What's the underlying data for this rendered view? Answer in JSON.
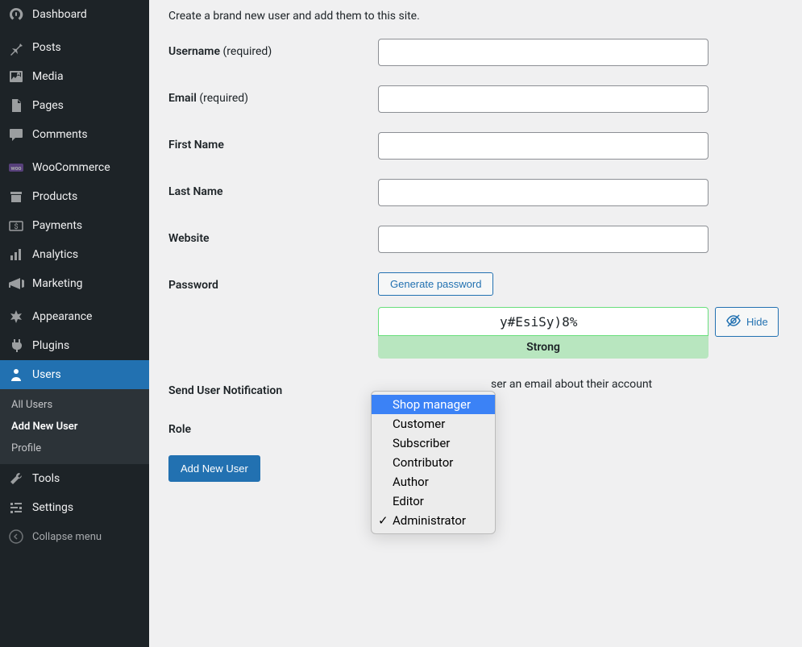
{
  "sidebar": {
    "items": [
      {
        "label": "Dashboard"
      },
      {
        "label": "Posts"
      },
      {
        "label": "Media"
      },
      {
        "label": "Pages"
      },
      {
        "label": "Comments"
      },
      {
        "label": "WooCommerce"
      },
      {
        "label": "Products"
      },
      {
        "label": "Payments"
      },
      {
        "label": "Analytics"
      },
      {
        "label": "Marketing"
      },
      {
        "label": "Appearance"
      },
      {
        "label": "Plugins"
      },
      {
        "label": "Users"
      },
      {
        "label": "Tools"
      },
      {
        "label": "Settings"
      }
    ],
    "submenu": {
      "items": [
        {
          "label": "All Users"
        },
        {
          "label": "Add New User"
        },
        {
          "label": "Profile"
        }
      ]
    },
    "collapse_label": "Collapse menu"
  },
  "page": {
    "intro": "Create a brand new user and add them to this site.",
    "fields": {
      "username_label": "Username",
      "username_req": "(required)",
      "email_label": "Email",
      "email_req": "(required)",
      "firstname_label": "First Name",
      "lastname_label": "Last Name",
      "website_label": "Website",
      "password_label": "Password",
      "generate_pw_label": "Generate password",
      "password_value": "y#EsiSy)8%",
      "strength_label": "Strong",
      "hide_label": "Hide",
      "notification_label": "Send User Notification",
      "notification_desc": "ser an email about their account",
      "role_label": "Role"
    },
    "submit_label": "Add New User"
  },
  "role_dropdown": {
    "options": [
      {
        "label": "Shop manager",
        "highlighted": true
      },
      {
        "label": "Customer"
      },
      {
        "label": "Subscriber"
      },
      {
        "label": "Contributor"
      },
      {
        "label": "Author"
      },
      {
        "label": "Editor"
      },
      {
        "label": "Administrator",
        "checked": true
      }
    ]
  }
}
